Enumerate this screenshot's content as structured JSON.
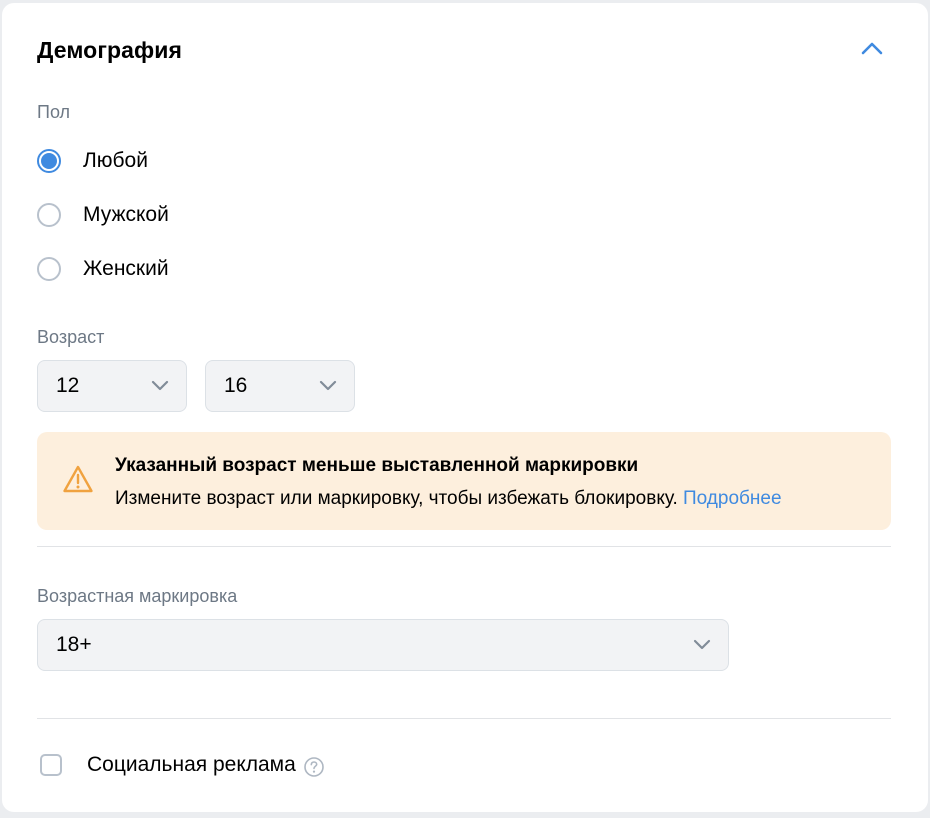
{
  "section": {
    "title": "Демография"
  },
  "gender": {
    "label": "Пол",
    "options": [
      {
        "label": "Любой",
        "checked": true
      },
      {
        "label": "Мужской",
        "checked": false
      },
      {
        "label": "Женский",
        "checked": false
      }
    ]
  },
  "age": {
    "label": "Возраст",
    "from_value": "12",
    "to_value": "16"
  },
  "warning": {
    "title": "Указанный возраст меньше выставленной маркировки",
    "text": "Измените возраст или маркировку, чтобы избежать блокировку.",
    "link": "Подробнее"
  },
  "age_rating": {
    "label": "Возрастная маркировка",
    "value": "18+"
  },
  "social_ad": {
    "label": "Социальная реклама",
    "checked": false
  },
  "icons": {
    "collapse": "chevron-up-icon",
    "dropdown": "chevron-down-icon",
    "warning": "warning-triangle-icon",
    "help": "question-circle-icon"
  },
  "colors": {
    "accent": "#3f8ae0",
    "warning_bg": "#fdefdd",
    "warning_icon": "#f0a23f",
    "secondary_text": "#6d7885"
  }
}
